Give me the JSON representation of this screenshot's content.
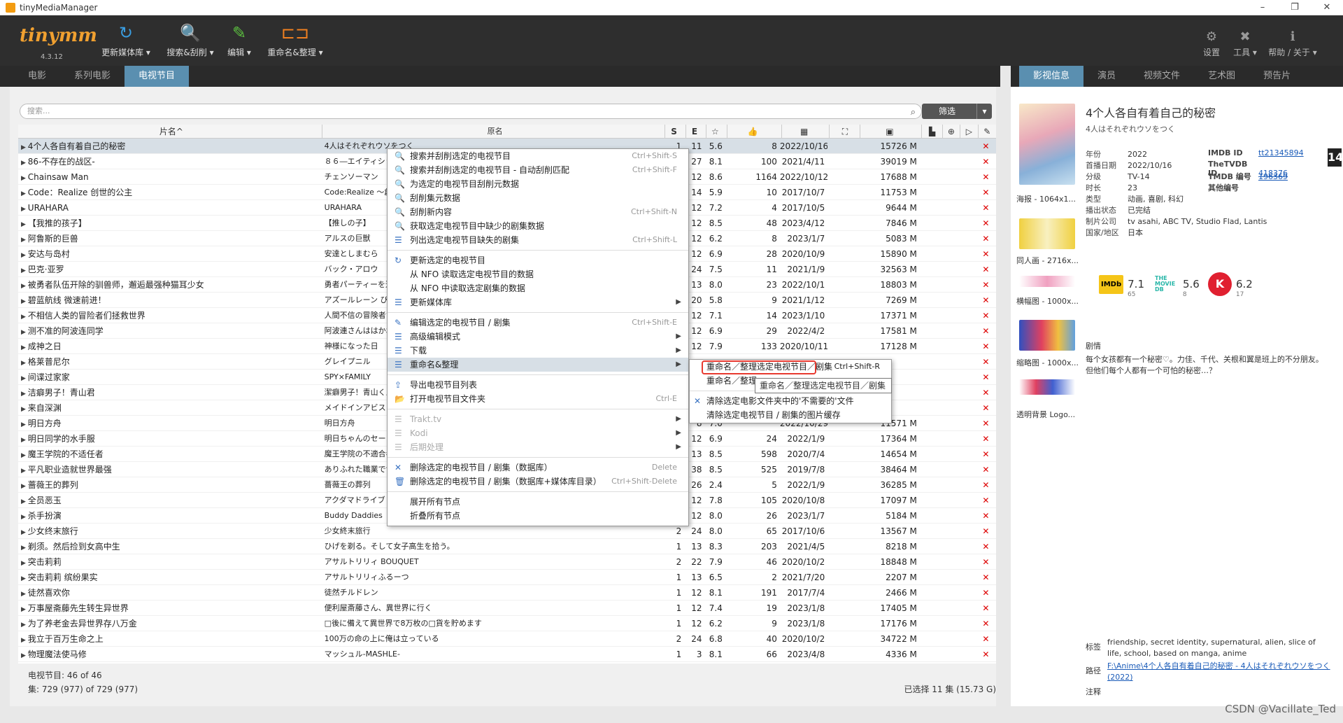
{
  "window": {
    "title": "tinyMediaManager",
    "min": "–",
    "restore": "❐",
    "close": "✕"
  },
  "toolbar": {
    "logo": "tinymm",
    "version": "4.3.12",
    "update": "更新媒体库 ▾",
    "search": "搜索&刮削 ▾",
    "edit": "编辑 ▾",
    "rename": "重命名&整理 ▾",
    "settings": "设置",
    "tools": "工具 ▾",
    "help": "帮助 / 关于 ▾"
  },
  "tabs_left": [
    "电影",
    "系列电影",
    "电视节目"
  ],
  "tabs_right": [
    "影视信息",
    "演员",
    "视频文件",
    "艺术图",
    "预告片"
  ],
  "search": {
    "placeholder": "搜索..."
  },
  "filter": {
    "label": "筛选"
  },
  "table": {
    "headers": {
      "title": "片名^",
      "original": "原名",
      "s": "S",
      "e": "E"
    },
    "rows": [
      {
        "t": "4个人各自有着自己的秘密",
        "o": "4人はそれぞれウソをつく",
        "s": "1",
        "e": "11",
        "r": "5.6",
        "v": "8",
        "d": "2022/10/16",
        "sz": "15726 M"
      },
      {
        "t": "86-不存在的战区-",
        "o": "８６―エイティシックス―",
        "s": "2",
        "e": "27",
        "r": "8.1",
        "v": "100",
        "d": "2021/4/11",
        "sz": "39019 M"
      },
      {
        "t": "Chainsaw Man",
        "o": "チェンソーマン",
        "s": "1",
        "e": "12",
        "r": "8.6",
        "v": "1164",
        "d": "2022/10/12",
        "sz": "17688 M"
      },
      {
        "t": "Code：Realize 创世的公主",
        "o": "Code:Realize ～創世の姫君～",
        "s": "2",
        "e": "14",
        "r": "5.9",
        "v": "10",
        "d": "2017/10/7",
        "sz": "11753 M"
      },
      {
        "t": "URAHARA",
        "o": "URAHARA",
        "s": "1",
        "e": "12",
        "r": "7.2",
        "v": "4",
        "d": "2017/10/5",
        "sz": "9644 M"
      },
      {
        "t": "【我推的孩子】",
        "o": "【推しの子】",
        "s": "2",
        "e": "12",
        "r": "8.5",
        "v": "48",
        "d": "2023/4/12",
        "sz": "7846 M"
      },
      {
        "t": "阿鲁斯的巨兽",
        "o": "アルスの巨獣",
        "s": "1",
        "e": "12",
        "r": "6.2",
        "v": "8",
        "d": "2023/1/7",
        "sz": "5083 M"
      },
      {
        "t": "安达与岛村",
        "o": "安達としまむら",
        "s": "1",
        "e": "12",
        "r": "6.9",
        "v": "28",
        "d": "2020/10/9",
        "sz": "15890 M"
      },
      {
        "t": "巴克·亚罗",
        "o": "バック・アロウ",
        "s": "1",
        "e": "24",
        "r": "7.5",
        "v": "11",
        "d": "2021/1/9",
        "sz": "32563 M"
      },
      {
        "t": "被勇者队伍开除的驯兽师，邂逅最强种猫耳少女",
        "o": "勇者パーティーを追放されたビーストテイマー",
        "s": "1",
        "e": "13",
        "r": "8.0",
        "v": "23",
        "d": "2022/10/1",
        "sz": "18803 M"
      },
      {
        "t": "碧蓝航线 微速前进！",
        "o": "アズールレーン びそくぜんしんっ！",
        "s": "2",
        "e": "20",
        "r": "5.8",
        "v": "9",
        "d": "2021/1/12",
        "sz": "7269 M"
      },
      {
        "t": "不相信人类的冒险者们拯救世界",
        "o": "人間不信の冒険者たちが世界を救うようです",
        "s": "1",
        "e": "12",
        "r": "7.1",
        "v": "14",
        "d": "2023/1/10",
        "sz": "17371 M"
      },
      {
        "t": "测不准的阿波连同学",
        "o": "阿波連さんははかれない",
        "s": "1",
        "e": "12",
        "r": "6.9",
        "v": "29",
        "d": "2022/4/2",
        "sz": "17581 M"
      },
      {
        "t": "成神之日",
        "o": "神様になった日",
        "s": "1",
        "e": "12",
        "r": "7.9",
        "v": "133",
        "d": "2020/10/11",
        "sz": "17128 M"
      },
      {
        "t": "格莱普尼尔",
        "o": "グレイプニル",
        "s": "",
        "e": "",
        "r": "",
        "v": "",
        "d": "",
        "sz": ""
      },
      {
        "t": "间谍过家家",
        "o": "SPY×FAMILY",
        "s": "",
        "e": "",
        "r": "",
        "v": "",
        "d": "",
        "sz": ""
      },
      {
        "t": "洁癖男子！青山君",
        "o": "潔癖男子！青山くん",
        "s": "",
        "e": "",
        "r": "",
        "v": "",
        "d": "",
        "sz": ""
      },
      {
        "t": "来自深渊",
        "o": "メイドインアビス",
        "s": "",
        "e": "",
        "r": "",
        "v": "",
        "d": "",
        "sz": ""
      },
      {
        "t": "明日方舟",
        "o": "明日方舟",
        "s": "1",
        "e": "8",
        "r": "7.0",
        "v": "",
        "d": "2022/10/29",
        "sz": "11571 M"
      },
      {
        "t": "明日同学的水手服",
        "o": "明日ちゃんのセーラー服",
        "s": "1",
        "e": "12",
        "r": "6.9",
        "v": "24",
        "d": "2022/1/9",
        "sz": "17364 M"
      },
      {
        "t": "魔王学院的不适任者",
        "o": "魔王学院の不適合者",
        "s": "1",
        "e": "13",
        "r": "8.5",
        "v": "598",
        "d": "2020/7/4",
        "sz": "14654 M"
      },
      {
        "t": "平凡职业造就世界最强",
        "o": "ありふれた職業で世界最強",
        "s": "3",
        "e": "38",
        "r": "8.5",
        "v": "525",
        "d": "2019/7/8",
        "sz": "38464 M"
      },
      {
        "t": "蔷薇王的葬列",
        "o": "薔薇王の葬列",
        "s": "2",
        "e": "26",
        "r": "2.4",
        "v": "5",
        "d": "2022/1/9",
        "sz": "36285 M"
      },
      {
        "t": "全员恶玉",
        "o": "アクダマドライブ",
        "s": "1",
        "e": "12",
        "r": "7.8",
        "v": "105",
        "d": "2020/10/8",
        "sz": "17097 M"
      },
      {
        "t": "杀手扮演",
        "o": "Buddy Daddies",
        "s": "1",
        "e": "12",
        "r": "8.0",
        "v": "26",
        "d": "2023/1/7",
        "sz": "5184 M"
      },
      {
        "t": "少女终末旅行",
        "o": "少女終末旅行",
        "s": "2",
        "e": "24",
        "r": "8.0",
        "v": "65",
        "d": "2017/10/6",
        "sz": "13567 M"
      },
      {
        "t": "剃须。然后捡到女高中生",
        "o": "ひげを剃る。そして女子高生を拾う。",
        "s": "1",
        "e": "13",
        "r": "8.3",
        "v": "203",
        "d": "2021/4/5",
        "sz": "8218 M"
      },
      {
        "t": "突击莉莉",
        "o": "アサルトリリィ BOUQUET",
        "s": "2",
        "e": "22",
        "r": "7.9",
        "v": "46",
        "d": "2020/10/2",
        "sz": "18848 M"
      },
      {
        "t": "突击莉莉 缤纷果实",
        "o": "アサルトリリィふるーつ",
        "s": "1",
        "e": "13",
        "r": "6.5",
        "v": "2",
        "d": "2021/7/20",
        "sz": "2207 M"
      },
      {
        "t": "徒然喜欢你",
        "o": "徒然チルドレン",
        "s": "1",
        "e": "12",
        "r": "8.1",
        "v": "191",
        "d": "2017/7/4",
        "sz": "2466 M"
      },
      {
        "t": "万事屋斋藤先生转生异世界",
        "o": "便利屋斎藤さん、異世界に行く",
        "s": "1",
        "e": "12",
        "r": "7.4",
        "v": "19",
        "d": "2023/1/8",
        "sz": "17405 M"
      },
      {
        "t": "为了养老金去异世界存八万金",
        "o": "□後に備えて異世界で8万枚の□貨を貯めます",
        "s": "1",
        "e": "12",
        "r": "6.2",
        "v": "9",
        "d": "2023/1/8",
        "sz": "17176 M"
      },
      {
        "t": "我立于百万生命之上",
        "o": "100万の命の上に俺は立っている",
        "s": "2",
        "e": "24",
        "r": "6.8",
        "v": "40",
        "d": "2020/10/2",
        "sz": "34722 M"
      },
      {
        "t": "物理魔法使马修",
        "o": "マッシュル-MASHLE-",
        "s": "1",
        "e": "3",
        "r": "8.1",
        "v": "66",
        "d": "2023/4/8",
        "sz": "4336 M"
      }
    ],
    "delete_mark": "✕"
  },
  "bottom": {
    "shows": "电视节目:  46  of  46",
    "episodes": "集:  729 (977)  of  729 (977)",
    "selected": "已选择 11 集 (15.73 G)"
  },
  "detail": {
    "title": "4个人各自有着自己的秘密",
    "subtitle": "4人はそれぞれウソをつく",
    "year_k": "年份",
    "year": "2022",
    "aired_k": "首播日期",
    "aired": "2022/10/16",
    "cert_k": "分级",
    "cert": "TV-14",
    "runtime_k": "时长",
    "runtime": "23",
    "genre_k": "类型",
    "genre": "动画, 喜剧, 科幻",
    "status_k": "播出状态",
    "status": "已完结",
    "studio_k": "制片公司",
    "studio": "tv asahi, ABC TV, Studio Flad, Lantis",
    "country_k": "国家/地区",
    "country": "日本",
    "imdb_k": "IMDB ID",
    "imdb": "tt21345894",
    "tvdb_k": "TheTVDB ID",
    "tvdb": "418376",
    "tmdb_k": "TMDB 编号",
    "tmdb": "196369",
    "other_k": "其他编号",
    "badge": "14",
    "poster_label": "海报 - 1064x1...",
    "fanart_label": "同人画 - 2716x...",
    "banner_label": "横幅图 - 1000x...",
    "thumb_label": "缩略图 - 1000x...",
    "logo_label": "透明背景 Logo...",
    "r_imdb": "7.1",
    "r_imdb_c": "65",
    "r_tvdb": "5.6",
    "r_tvdb_c": "8",
    "r_k": "6.2",
    "r_k_c": "17",
    "plot_k": "剧情",
    "plot": "每个女孩都有一个秘密♡。力佳、千代、关根和翼是班上的不分朋友。但他们每个人都有一个可怕的秘密…？",
    "tags_k": "标签",
    "tags": "friendship, secret identity, supernatural, alien, slice of life, school, based on manga, anime",
    "path_k": "路径",
    "path": "F:\\Anime\\4个人各自有着自己的秘密 - 4人はそれぞれウソをつく (2022)",
    "note_k": "注释"
  },
  "menu": [
    {
      "l": "搜索并刮削选定的电视节目",
      "sc": "Ctrl+Shift-S",
      "ic": "🔍"
    },
    {
      "l": "搜索并刮削选定的电视节目 - 自动刮削匹配",
      "sc": "Ctrl+Shift-F",
      "ic": "🔍"
    },
    {
      "l": "为选定的电视节目刮削元数据",
      "sc": "",
      "ic": "🔍"
    },
    {
      "l": "刮削集元数据",
      "sc": "",
      "ic": "🔍"
    },
    {
      "l": "刮削新内容",
      "sc": "Ctrl+Shift-N",
      "ic": "🔍"
    },
    {
      "l": "获取选定电视节目中缺少的剧集数据",
      "sc": "",
      "ic": "🔍"
    },
    {
      "l": "列出选定电视节目缺失的剧集",
      "sc": "Ctrl+Shift-L",
      "ic": "☰"
    },
    {
      "sep": true
    },
    {
      "l": "更新选定的电视节目",
      "sc": "",
      "ic": "↻"
    },
    {
      "l": "从 NFO 读取选定电视节目的数据",
      "sc": "",
      "ic": ""
    },
    {
      "l": "从 NFO 中读取选定剧集的数据",
      "sc": "",
      "ic": ""
    },
    {
      "l": "更新媒体库",
      "arr": "▶",
      "ic": "☰"
    },
    {
      "sep": true
    },
    {
      "l": "编辑选定的电视节目 / 剧集",
      "sc": "Ctrl+Shift-E",
      "ic": "✎"
    },
    {
      "l": "高级编辑模式",
      "arr": "▶",
      "ic": "☰"
    },
    {
      "l": "下载",
      "arr": "▶",
      "ic": "☰"
    },
    {
      "l": "重命名&整理",
      "arr": "▶",
      "ic": "☰",
      "hl": true
    },
    {
      "sep": true
    },
    {
      "l": "导出电视节目列表",
      "ic": "⇪"
    },
    {
      "l": "打开电视节目文件夹",
      "sc": "Ctrl-E",
      "ic": "📂"
    },
    {
      "sep": true
    },
    {
      "l": "Trakt.tv",
      "arr": "▶",
      "ic": "☰",
      "dis": true
    },
    {
      "l": "Kodi",
      "arr": "▶",
      "ic": "☰",
      "dis": true
    },
    {
      "l": "后期处理",
      "arr": "▶",
      "ic": "☰",
      "dis": true
    },
    {
      "sep": true
    },
    {
      "l": "删除选定的电视节目 / 剧集（数据库）",
      "sc": "Delete",
      "ic": "✕"
    },
    {
      "l": "删除选定的电视节目 / 剧集（数据库+媒体库目录）",
      "sc": "Ctrl+Shift-Delete",
      "ic": "🗑"
    },
    {
      "sep": true
    },
    {
      "l": "展开所有节点",
      "ic": ""
    },
    {
      "l": "折叠所有节点",
      "ic": ""
    }
  ],
  "submenu": [
    {
      "l": "重命名／整理选定电视节目／剧集",
      "sc": "Ctrl+Shift-R"
    },
    {
      "l": "重命名／整理",
      "sc": ""
    },
    {
      "sep": true
    },
    {
      "l": "清除选定电影文件夹中的'不需要的'文件",
      "ic": "✕"
    },
    {
      "l": "清除选定电视节目 / 剧集的图片缓存",
      "ic": ""
    }
  ],
  "tooltip": "重命名／整理选定电视节目／剧集",
  "watermark": "CSDN @Vacillate_Ted"
}
